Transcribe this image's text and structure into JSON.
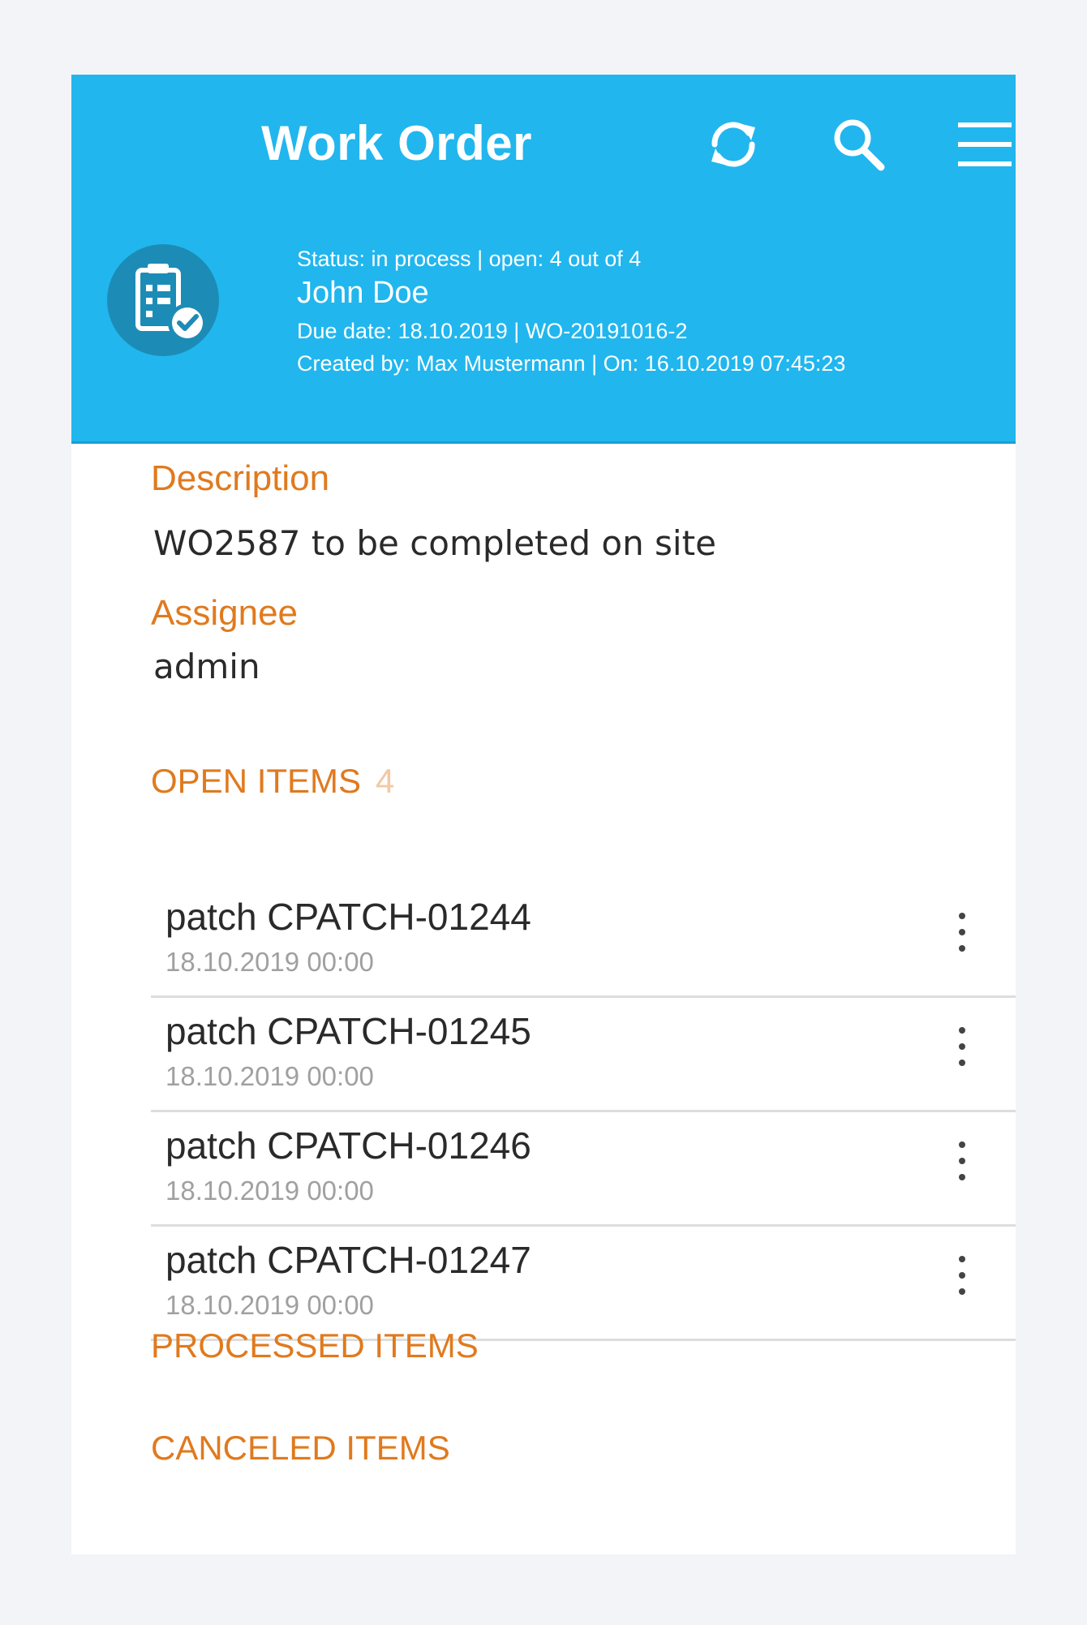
{
  "appbar": {
    "title": "Work Order",
    "icons": [
      "refresh-icon",
      "search-icon",
      "menu-icon"
    ]
  },
  "header": {
    "status_line": "Status: in process | open: 4 out of 4",
    "name": "John Doe",
    "due_line": "Due date: 18.10.2019 | WO-20191016-2",
    "created_line": "Created by: Max Mustermann |  On: 16.10.2019 07:45:23"
  },
  "description": {
    "label": "Description",
    "value": "WO2587 to be completed on site"
  },
  "assignee": {
    "label": "Assignee",
    "value": "admin"
  },
  "open_items": {
    "label": "OPEN ITEMS",
    "count": "4",
    "items": [
      {
        "title": "patch CPATCH-01244",
        "date": "18.10.2019 00:00"
      },
      {
        "title": "patch CPATCH-01245",
        "date": "18.10.2019 00:00"
      },
      {
        "title": "patch CPATCH-01246",
        "date": "18.10.2019 00:00"
      },
      {
        "title": "patch CPATCH-01247",
        "date": "18.10.2019 00:00"
      }
    ]
  },
  "processed_items": {
    "label": "PROCESSED ITEMS"
  },
  "canceled_items": {
    "label": "CANCELED ITEMS"
  },
  "colors": {
    "primary": "#21b6ee",
    "accent": "#e07a1e",
    "avatar_bg": "#1c8cb6"
  }
}
